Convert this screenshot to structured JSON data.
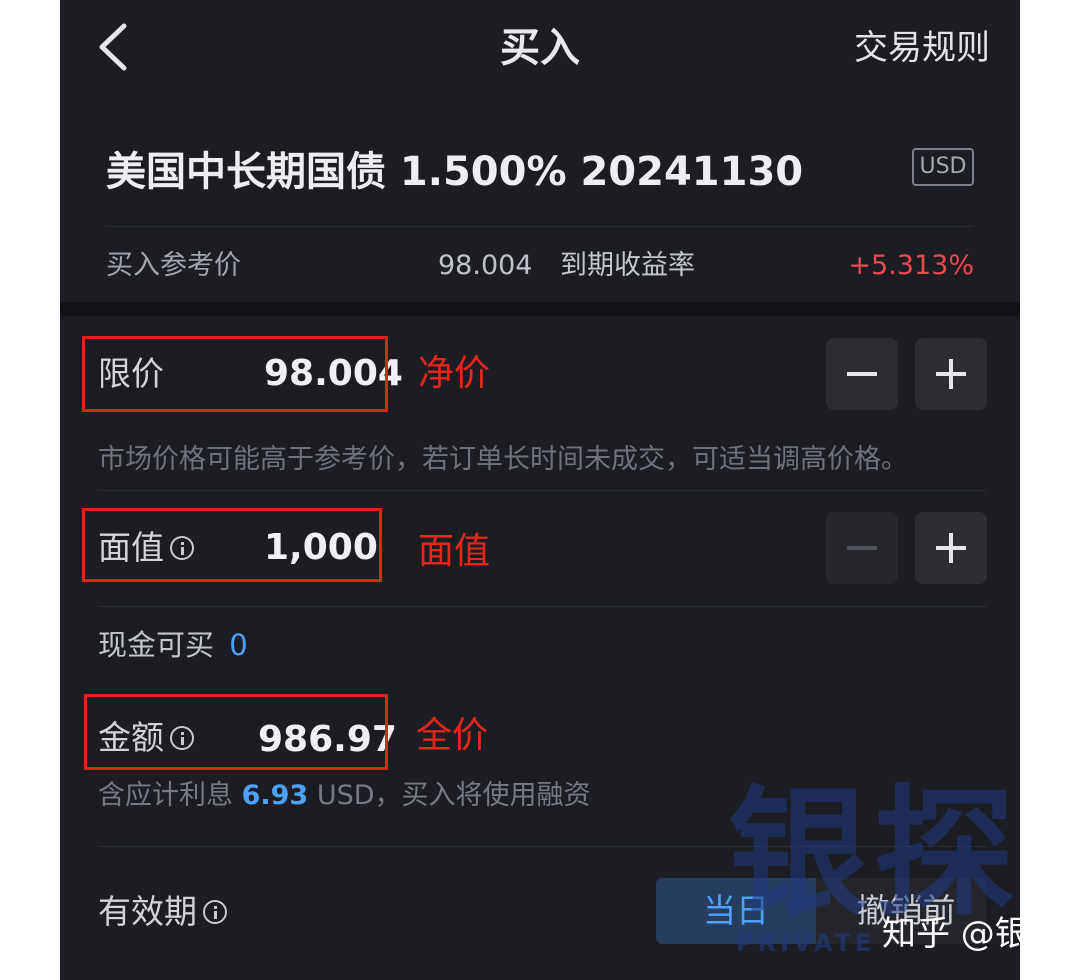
{
  "header": {
    "title": "买入",
    "rules_link": "交易规则"
  },
  "bond": {
    "name": "美国中长期国债 1.500% 20241130",
    "currency": "USD",
    "ref_price_label": "买入参考价",
    "ref_price_value": "98.004",
    "ytm_label": "到期收益率",
    "ytm_value": "+5.313%"
  },
  "limit_price": {
    "label": "限价",
    "value": "98.004",
    "annotation": "净价",
    "hint": "市场价格可能高于参考价，若订单长时间未成交，可适当调高价格。"
  },
  "face_value": {
    "label": "面值",
    "value": "1,000",
    "annotation": "面值"
  },
  "cash": {
    "label": "现金可买",
    "value": "0"
  },
  "amount": {
    "label": "金额",
    "value": "986.97",
    "annotation": "全价",
    "accrued_prefix": "含应计利息",
    "accrued_value": "6.93",
    "accrued_suffix": "USD，买入将使用融资"
  },
  "validity": {
    "label": "有效期",
    "options": [
      "当日",
      "撤销前"
    ],
    "selected": "当日"
  },
  "watermarks": {
    "big": "银探",
    "small": "PRIVATE",
    "zhihu": "知乎 @银探"
  },
  "colors": {
    "background": "#1c1d22",
    "positive_red": "#ea4a52",
    "accent_blue": "#4ea1ff",
    "annotation_red": "#e2231a"
  }
}
